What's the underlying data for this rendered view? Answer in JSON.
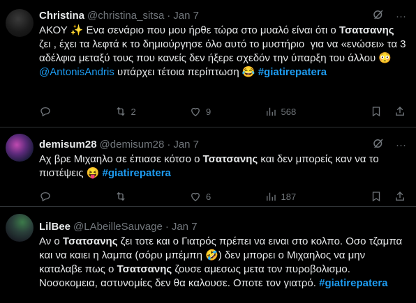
{
  "tweets": [
    {
      "name": "Christina",
      "handle": "@christina_sitsa",
      "date": "Jan 7",
      "text_1": "ΑΚΟΥ ✨ Ενα σενάριο που μου ήρθε τώρα στο μυαλό είναι ότι ο ",
      "bold_1": "Τσατσανης",
      "text_2": " ζει , έχει τα λεφτά κ το δημιούργησε όλο αυτό το μυστήριο  για να «ενώσει» τα 3 αδέλφια μεταξύ τους που κανείς δεν ήξερε σχεδόν την ύπαρξη του άλλου 😳 ",
      "mention": "@AntonisAndris",
      "text_3": " υπάρχει τέτοια περίπτωση 😂 ",
      "hashtag": "#giatirepatera",
      "replies": "",
      "retweets": "2",
      "likes": "9",
      "views": "568"
    },
    {
      "name": "demisum28",
      "handle": "@demisum28",
      "date": "Jan 7",
      "text_1": "Αχ βρε Μιχαηλο σε έπιασε κότσο ο ",
      "bold_1": "Τσατσανης",
      "text_2": " και δεν μπορείς καν να το πιστέψεις 😝 ",
      "hashtag": "#giatirepatera",
      "replies": "",
      "retweets": "",
      "likes": "6",
      "views": "187"
    },
    {
      "name": "LilBee",
      "handle": "@LAbeilleSauvage",
      "date": "Jan 7",
      "text_1": "Αν ο ",
      "bold_1": "Τσατσανης",
      "text_2": " ζει τοτε και ο Γιατρός πρέπει να ειναι στο κολπο. Οσο τζαμπα και να καιει η λαμπα (σόρυ μπέμπη 🤣) δεν μπορει ο Μιχαηλος να μην καταλαβε πως ο ",
      "bold_2": "Τσατσανης",
      "text_3": " ζουσε αμεσως μετα τον πυροβολισμο. Νοσοκομεια, αστυνομίες δεν θα καλουσε. Οποτε τον γιατρό. ",
      "hashtag": "#giatirepatera"
    }
  ],
  "icons": {
    "grok": "grok-icon",
    "more": "more-icon",
    "reply": "reply-icon",
    "retweet": "retweet-icon",
    "like": "like-icon",
    "views": "views-icon",
    "bookmark": "bookmark-icon",
    "share": "share-icon"
  },
  "colors": {
    "background": "#000000",
    "text": "#e7e9ea",
    "muted": "#71767b",
    "link": "#1d9bf0",
    "divider": "#2f3336"
  }
}
